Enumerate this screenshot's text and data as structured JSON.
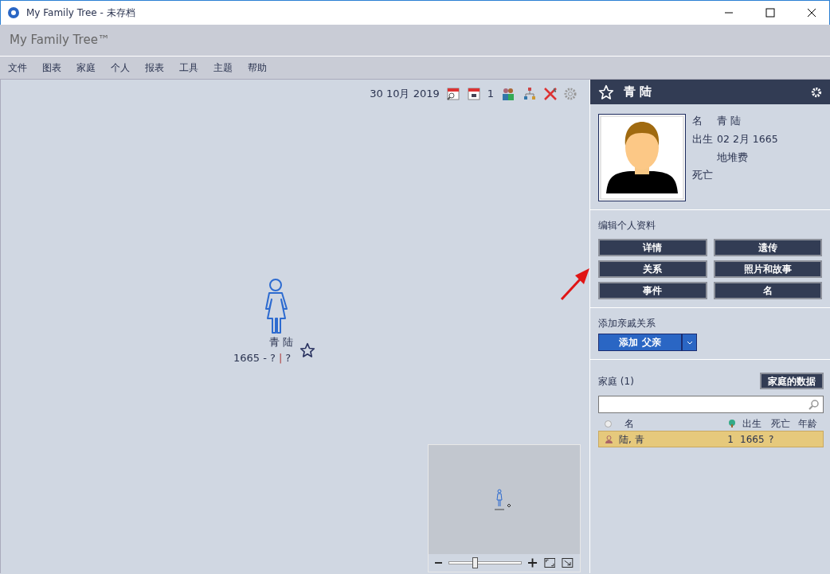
{
  "window": {
    "title": "My Family Tree - 未存档"
  },
  "app_header": "My Family Tree™",
  "menu": [
    "文件",
    "图表",
    "家庭",
    "个人",
    "报表",
    "工具",
    "主题",
    "帮助"
  ],
  "toolbar": {
    "date": "30 10月 2019",
    "people_count": "1"
  },
  "canvas": {
    "person": {
      "name": "青 陆",
      "lifespan": "1665 - ?",
      "separator": "|",
      "age": "?",
      "favorite": false
    }
  },
  "minimap": {
    "zoom": {
      "level": 0.36
    }
  },
  "panel": {
    "title": "青 陆",
    "favorite": false,
    "fields": [
      {
        "label": "名",
        "value": "青 陆"
      },
      {
        "label": "出生",
        "value": "02 2月 1665",
        "place": "地堆费"
      },
      {
        "label": "死亡"
      }
    ],
    "edit": {
      "heading": "编辑个人资料",
      "buttons": [
        "详情",
        "遗传",
        "关系",
        "照片和故事",
        "事件",
        "名"
      ]
    },
    "add_relative": {
      "heading": "添加亲戚关系",
      "button": "添加 父亲"
    },
    "family": {
      "heading": "家庭 (1)",
      "data_button": "家庭的数据",
      "columns": [
        "名",
        "出生",
        "死亡",
        "年龄"
      ],
      "rows": [
        {
          "name": "陆, 青",
          "tree": "1",
          "birth": "1665",
          "death": "?",
          "selected": true
        }
      ]
    }
  }
}
